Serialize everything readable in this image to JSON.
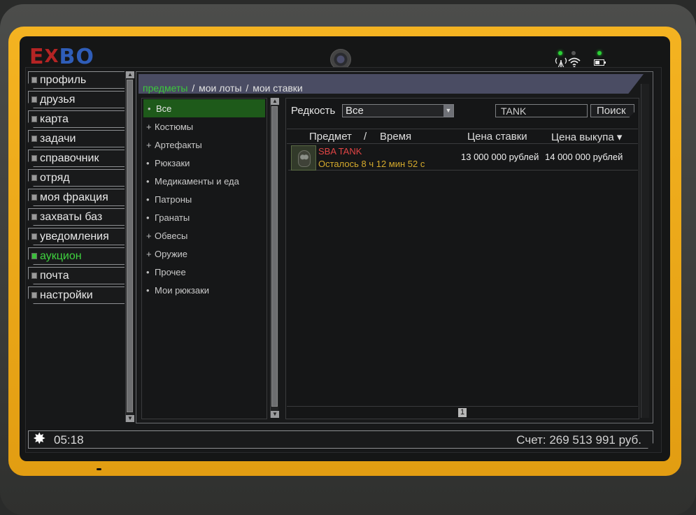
{
  "brand": {
    "logo_e": "E",
    "logo_x": "X",
    "logo_bo": "BO"
  },
  "status_icons": {
    "signal": "antenna-icon",
    "wifi": "wifi-icon",
    "battery": "battery-icon"
  },
  "sidebar": {
    "items": [
      {
        "label": "профиль",
        "active": false
      },
      {
        "label": "друзья",
        "active": false
      },
      {
        "label": "карта",
        "active": false
      },
      {
        "label": "задачи",
        "active": false
      },
      {
        "label": "справочник",
        "active": false
      },
      {
        "label": "отряд",
        "active": false
      },
      {
        "label": "моя фракция",
        "active": false
      },
      {
        "label": "захваты баз",
        "active": false
      },
      {
        "label": "уведомления",
        "active": false
      },
      {
        "label": "аукцион",
        "active": true
      },
      {
        "label": "почта",
        "active": false
      },
      {
        "label": "настройки",
        "active": false
      }
    ]
  },
  "tabs": {
    "items": "предметы",
    "my_lots": "мои лоты",
    "my_bids": "мои ставки",
    "separator": "/"
  },
  "categories": [
    {
      "mark": "•",
      "label": "Все",
      "active": true
    },
    {
      "mark": "+",
      "label": "Костюмы"
    },
    {
      "mark": "+",
      "label": "Артефакты"
    },
    {
      "mark": "•",
      "label": "Рюкзаки"
    },
    {
      "mark": "•",
      "label": "Медикаменты и еда"
    },
    {
      "mark": "•",
      "label": "Патроны"
    },
    {
      "mark": "•",
      "label": "Гранаты"
    },
    {
      "mark": "+",
      "label": "Обвесы"
    },
    {
      "mark": "+",
      "label": "Оружие"
    },
    {
      "mark": "•",
      "label": "Прочее"
    },
    {
      "mark": "•",
      "label": "Мои рюкзаки"
    }
  ],
  "filters": {
    "rarity_label": "Редкость",
    "rarity_value": "Все",
    "search_value": "TANK",
    "search_button": "Поиск"
  },
  "table": {
    "headers": {
      "item": "Предмет",
      "slash": "/",
      "time": "Время",
      "bid": "Цена ставки",
      "buyout": "Цена выкупа ▾"
    },
    "rows": [
      {
        "name": "SBA TANK",
        "time_left": "Осталось 8 ч 12 мин 52 с",
        "bid": "13 000 000 рублей",
        "buyout": "14 000 000 рублей"
      }
    ]
  },
  "pager": {
    "current": "1"
  },
  "statusbar": {
    "time": "05:18",
    "account": "Счет: 269 513 991 руб."
  },
  "colors": {
    "accent_green": "#3fd23f",
    "item_red": "#e04444",
    "timer_gold": "#d4a92c",
    "frame_orange": "#f4b321"
  }
}
